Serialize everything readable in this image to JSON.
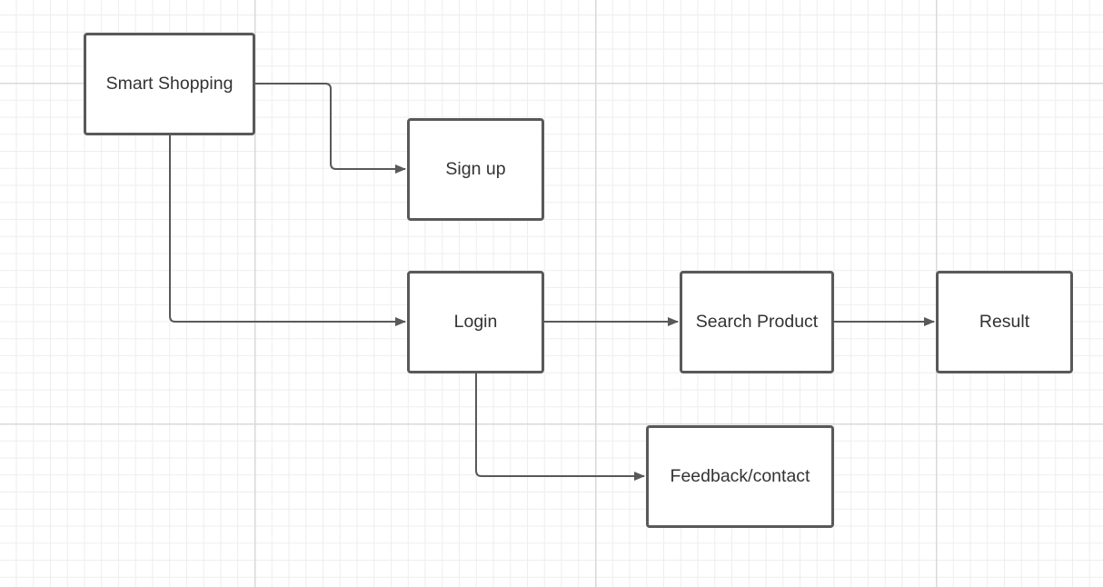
{
  "diagram": {
    "nodes": {
      "smart_shopping": "Smart Shopping",
      "sign_up": "Sign up",
      "login": "Login",
      "search_product": "Search Product",
      "result": "Result",
      "feedback_contact": "Feedback/contact"
    },
    "edges": [
      {
        "from": "Smart Shopping",
        "to": "Sign up"
      },
      {
        "from": "Smart Shopping",
        "to": "Login"
      },
      {
        "from": "Login",
        "to": "Search Product"
      },
      {
        "from": "Search Product",
        "to": "Result"
      },
      {
        "from": "Login",
        "to": "Feedback/contact"
      }
    ],
    "colors": {
      "node_border": "#595959",
      "connector": "#595959",
      "text": "#333333",
      "grid_major": "#d9d9d9",
      "grid_minor": "#eeeeee"
    }
  }
}
